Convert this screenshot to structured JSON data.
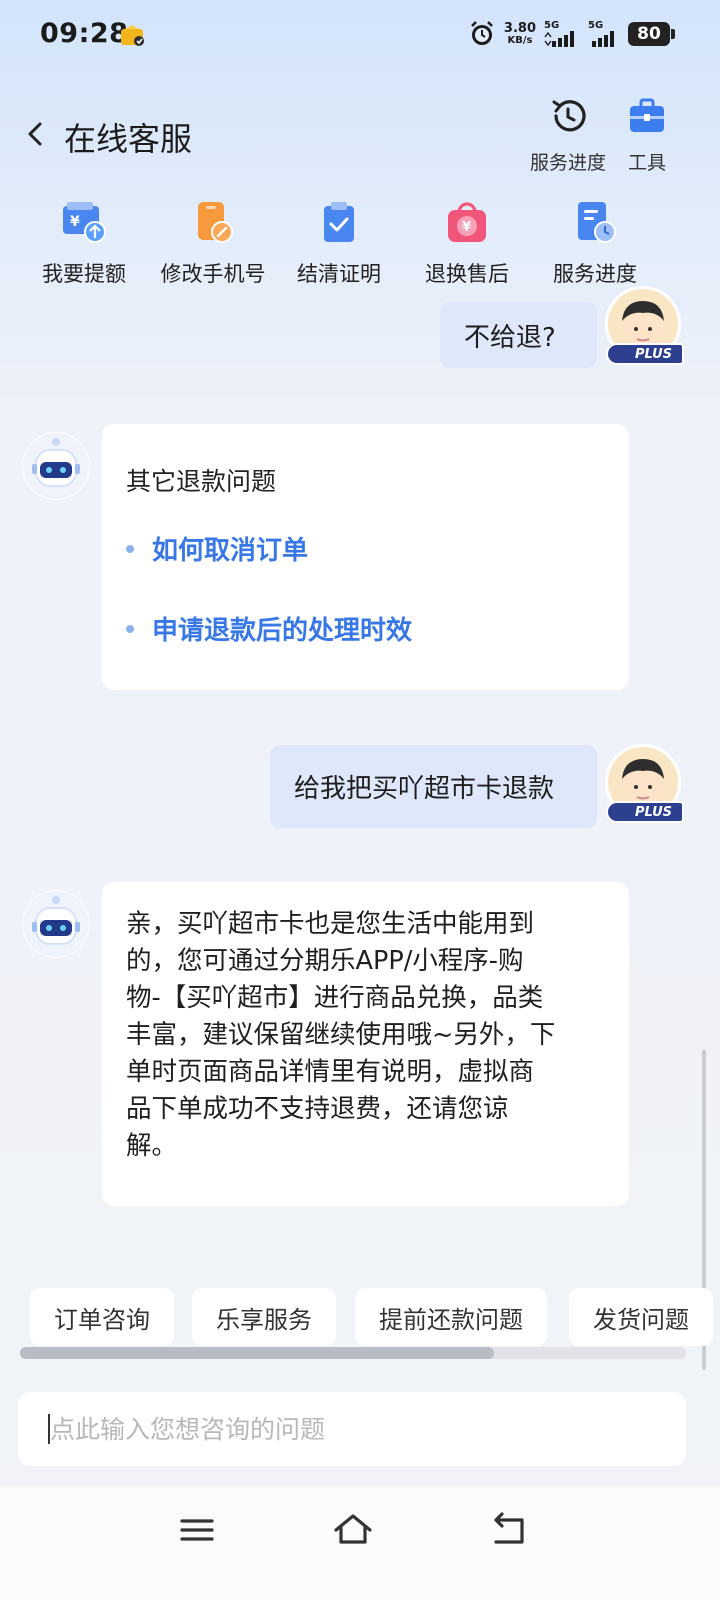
{
  "status_bar": {
    "time": "09:28",
    "net_speed_value": "3.80",
    "net_speed_unit": "KB/s",
    "sim1_label": "5G",
    "sim2_label": "5G",
    "battery": "80"
  },
  "header": {
    "title": "在线客服",
    "actions": [
      {
        "label": "服务进度",
        "icon": "clock-history-icon"
      },
      {
        "label": "工具",
        "icon": "toolbox-icon"
      }
    ]
  },
  "shortcuts": [
    {
      "label": "我要提额",
      "icon": "wallet-upload-icon"
    },
    {
      "label": "修改手机号",
      "icon": "phone-edit-icon"
    },
    {
      "label": "结清证明",
      "icon": "clipboard-check-icon"
    },
    {
      "label": "退换售后",
      "icon": "shopping-bag-yen-icon"
    },
    {
      "label": "服务进度",
      "icon": "document-clock-icon"
    }
  ],
  "messages": {
    "user_1": "不给退?",
    "bot_card": {
      "title": "其它退款问题",
      "items": [
        "如何取消订单",
        "申请退款后的处理时效"
      ]
    },
    "user_2": "给我把买吖超市卡退款",
    "bot_answer_lines": [
      "亲，买吖超市卡也是您生活中能用到",
      "的，您可通过分期乐APP/小程序-购",
      "物-【买吖超市】进行商品兑换，品类",
      "丰富，建议保留继续使用哦~另外，下",
      "单时页面商品详情里有说明，虚拟商",
      "品下单成功不支持退费，还请您谅",
      "解。"
    ],
    "user_badge": "PLUS"
  },
  "quick_chips": [
    "订单咨询",
    "乐享服务",
    "提前还款问题",
    "发货问题"
  ],
  "input": {
    "placeholder": "点此输入您想咨询的问题"
  },
  "colors": {
    "link_blue": "#3777e6",
    "user_bubble": "#dfe8fb",
    "icon_blue": "#4a86f0",
    "icon_orange": "#f79a3e",
    "icon_pink": "#f0567a"
  }
}
